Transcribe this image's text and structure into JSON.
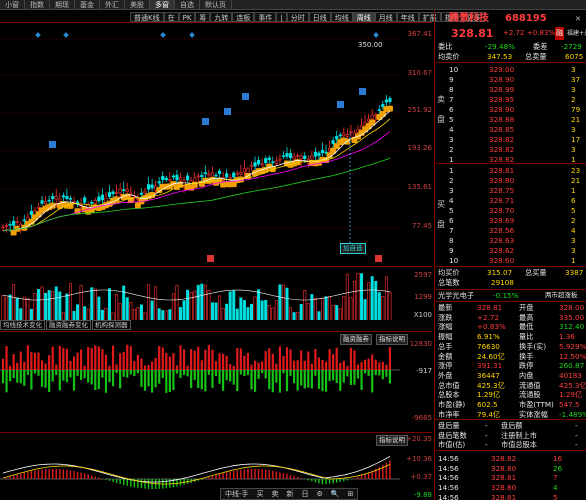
{
  "tabs": [
    "小窗",
    "指数",
    "期现",
    "基金",
    "外汇",
    "美股",
    "多窗",
    "自选",
    "默认页"
  ],
  "chart_toolbar": [
    "普通K线",
    "在",
    "PK",
    "筹",
    "九转",
    "连板",
    "事件",
    "|",
    "分时",
    "日线",
    "均线",
    "周线",
    "月线",
    "年线",
    "扩展",
    "指明",
    "更多"
  ],
  "main_axis": [
    "367.41",
    "310.67",
    "251.92",
    "193.26",
    "135.61",
    "77.45"
  ],
  "main_annot": {
    "peak": "350.00",
    "tag": "加自选"
  },
  "vol_axis": [
    "2597",
    "1299",
    "X100"
  ],
  "mid_buttons": [
    "融资融券",
    "指标说明",
    "指标说明"
  ],
  "mid_axis": [
    "12830",
    "-917",
    "-9665"
  ],
  "macd_axis": [
    "+20.35",
    "+10.36",
    "+0.37",
    "-9.88"
  ],
  "subbar": [
    "均线技术变化",
    "融资融券变化",
    "机构探测器"
  ],
  "bottom_bar": [
    "中线-手",
    "买",
    "卖",
    "新",
    "日",
    "⚙",
    "🔍",
    "⊞"
  ],
  "stock": {
    "code_tag": "688195",
    "name": "腾景科技",
    "code": "688195",
    "price": "328.81",
    "chg": "+2.72",
    "pct": "+0.83%",
    "flag": "融",
    "group": "福建+光"
  },
  "weibi": {
    "l1": "委比",
    "v1": "-29.48%",
    "l2": "委差",
    "v2": "-2729"
  },
  "avg": {
    "l": "均卖价",
    "v": "347.53",
    "l2": "总卖量",
    "v2": "6075"
  },
  "asks": [
    [
      "10",
      "329.00",
      "3"
    ],
    [
      "9",
      "328.90",
      "37"
    ],
    [
      "8",
      "328.99",
      "3"
    ],
    [
      "7",
      "328.95",
      "2"
    ],
    [
      "6",
      "328.90",
      "79"
    ],
    [
      "5",
      "328.88",
      "21"
    ],
    [
      "4",
      "328.85",
      "3"
    ],
    [
      "3",
      "328.82",
      "17"
    ],
    [
      "2",
      "328.82",
      "3"
    ],
    [
      "1",
      "328.82",
      "1"
    ]
  ],
  "bids": [
    [
      "1",
      "328.81",
      "23"
    ],
    [
      "2",
      "328.80",
      "21"
    ],
    [
      "3",
      "328.75",
      "1"
    ],
    [
      "4",
      "328.71",
      "6"
    ],
    [
      "5",
      "328.70",
      "5"
    ],
    [
      "6",
      "328.69",
      "2"
    ],
    [
      "7",
      "328.56",
      "4"
    ],
    [
      "8",
      "328.63",
      "3"
    ],
    [
      "9",
      "328.62",
      "3"
    ],
    [
      "10",
      "328.60",
      "1"
    ]
  ],
  "buy_avg": {
    "l": "均买价",
    "v": "315.07",
    "l2": "总买量",
    "v2": "3387"
  },
  "total_vol": {
    "l": "总笔数",
    "v": "29108"
  },
  "concept": {
    "l": "光学光电子",
    "v": "-0.15%",
    "r": "两市超涨板"
  },
  "stats": [
    [
      "最新",
      "328.81",
      "开盘",
      "328.00"
    ],
    [
      "涨跌",
      "+2.72",
      "最高",
      "335.00"
    ],
    [
      "涨幅",
      "+0.83%",
      "最低",
      "312.40"
    ],
    [
      "振幅",
      "6.91%",
      "量比",
      "1.36"
    ],
    [
      "总手",
      "76630",
      "换手(实)",
      "5.929%"
    ],
    [
      "金额",
      "24.60亿",
      "换手",
      "12.50%"
    ],
    [
      "涨停",
      "391.31",
      "跌停",
      "260.87"
    ],
    [
      "外盘",
      "36447",
      "内盘",
      "40183"
    ],
    [
      "总市值",
      "425.3亿",
      "流通值",
      "425.3亿"
    ],
    [
      "总股本",
      "1.29亿",
      "流通股",
      "1.29亿"
    ],
    [
      "市盈(静)",
      "602.5",
      "市盈(TTM)",
      "547.5"
    ],
    [
      "市净率",
      "79.4亿",
      "实体涨幅",
      "-1.489%"
    ]
  ],
  "extra": [
    [
      "盘后量",
      "-",
      "盘后额",
      "-"
    ],
    [
      "盘后笔数",
      "-",
      "注册制上市",
      "-"
    ],
    [
      "市值(估)",
      "-",
      "市值总股本",
      "-"
    ]
  ],
  "ticks": [
    [
      "14:56",
      "328.82",
      "16"
    ],
    [
      "14:56",
      "328.80",
      "26"
    ],
    [
      "14:56",
      "328.81",
      "7"
    ],
    [
      "14:56",
      "328.80",
      "4"
    ],
    [
      "14:56",
      "328.81",
      "5"
    ]
  ]
}
